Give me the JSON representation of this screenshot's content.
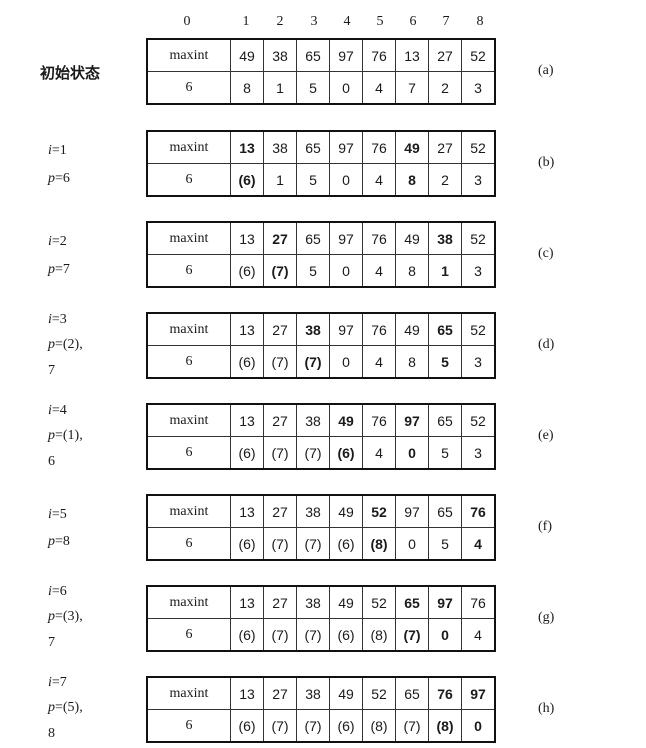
{
  "header_indices": [
    "0",
    "1",
    "2",
    "3",
    "4",
    "5",
    "6",
    "7",
    "8"
  ],
  "panels": [
    {
      "tag": "(a)",
      "label_lines": [
        "初始状态"
      ],
      "row1": [
        {
          "v": "maxint"
        },
        {
          "v": "49"
        },
        {
          "v": "38"
        },
        {
          "v": "65"
        },
        {
          "v": "97"
        },
        {
          "v": "76"
        },
        {
          "v": "13"
        },
        {
          "v": "27"
        },
        {
          "v": "52"
        }
      ],
      "row2": [
        {
          "v": "6"
        },
        {
          "v": "8"
        },
        {
          "v": "1"
        },
        {
          "v": "5"
        },
        {
          "v": "0"
        },
        {
          "v": "4"
        },
        {
          "v": "7"
        },
        {
          "v": "2"
        },
        {
          "v": "3"
        }
      ]
    },
    {
      "tag": "(b)",
      "label_lines": [
        "i=1",
        "p=6"
      ],
      "row1": [
        {
          "v": "maxint"
        },
        {
          "v": "13",
          "b": true
        },
        {
          "v": "38"
        },
        {
          "v": "65"
        },
        {
          "v": "97"
        },
        {
          "v": "76"
        },
        {
          "v": "49",
          "b": true
        },
        {
          "v": "27"
        },
        {
          "v": "52"
        }
      ],
      "row2": [
        {
          "v": "6"
        },
        {
          "v": "(6)",
          "b": true
        },
        {
          "v": "1"
        },
        {
          "v": "5"
        },
        {
          "v": "0"
        },
        {
          "v": "4"
        },
        {
          "v": "8",
          "b": true
        },
        {
          "v": "2"
        },
        {
          "v": "3"
        }
      ]
    },
    {
      "tag": "(c)",
      "label_lines": [
        "i=2",
        "p=7"
      ],
      "row1": [
        {
          "v": "maxint"
        },
        {
          "v": "13"
        },
        {
          "v": "27",
          "b": true
        },
        {
          "v": "65"
        },
        {
          "v": "97"
        },
        {
          "v": "76"
        },
        {
          "v": "49"
        },
        {
          "v": "38",
          "b": true
        },
        {
          "v": "52"
        }
      ],
      "row2": [
        {
          "v": "6"
        },
        {
          "v": "(6)"
        },
        {
          "v": "(7)",
          "b": true
        },
        {
          "v": "5"
        },
        {
          "v": "0"
        },
        {
          "v": "4"
        },
        {
          "v": "8"
        },
        {
          "v": "1",
          "b": true
        },
        {
          "v": "3"
        }
      ]
    },
    {
      "tag": "(d)",
      "label_lines": [
        "i=3",
        "p=(2),",
        "7"
      ],
      "row1": [
        {
          "v": "maxint"
        },
        {
          "v": "13"
        },
        {
          "v": "27"
        },
        {
          "v": "38",
          "b": true
        },
        {
          "v": "97"
        },
        {
          "v": "76"
        },
        {
          "v": "49"
        },
        {
          "v": "65",
          "b": true
        },
        {
          "v": "52"
        }
      ],
      "row2": [
        {
          "v": "6"
        },
        {
          "v": "(6)"
        },
        {
          "v": "(7)"
        },
        {
          "v": "(7)",
          "b": true
        },
        {
          "v": "0"
        },
        {
          "v": "4"
        },
        {
          "v": "8"
        },
        {
          "v": "5",
          "b": true
        },
        {
          "v": "3"
        }
      ]
    },
    {
      "tag": "(e)",
      "label_lines": [
        "i=4",
        "p=(1),",
        "6"
      ],
      "row1": [
        {
          "v": "maxint"
        },
        {
          "v": "13"
        },
        {
          "v": "27"
        },
        {
          "v": "38"
        },
        {
          "v": "49",
          "b": true
        },
        {
          "v": "76"
        },
        {
          "v": "97",
          "b": true
        },
        {
          "v": "65"
        },
        {
          "v": "52"
        }
      ],
      "row2": [
        {
          "v": "6"
        },
        {
          "v": "(6)"
        },
        {
          "v": "(7)"
        },
        {
          "v": "(7)"
        },
        {
          "v": "(6)",
          "b": true
        },
        {
          "v": "4"
        },
        {
          "v": "0",
          "b": true
        },
        {
          "v": "5"
        },
        {
          "v": "3"
        }
      ]
    },
    {
      "tag": "(f)",
      "label_lines": [
        "i=5",
        "p=8"
      ],
      "row1": [
        {
          "v": "maxint"
        },
        {
          "v": "13"
        },
        {
          "v": "27"
        },
        {
          "v": "38"
        },
        {
          "v": "49"
        },
        {
          "v": "52",
          "b": true
        },
        {
          "v": "97"
        },
        {
          "v": "65"
        },
        {
          "v": "76",
          "b": true
        }
      ],
      "row2": [
        {
          "v": "6"
        },
        {
          "v": "(6)"
        },
        {
          "v": "(7)"
        },
        {
          "v": "(7)"
        },
        {
          "v": "(6)"
        },
        {
          "v": "(8)",
          "b": true
        },
        {
          "v": "0"
        },
        {
          "v": "5"
        },
        {
          "v": "4",
          "b": true
        }
      ]
    },
    {
      "tag": "(g)",
      "label_lines": [
        "i=6",
        "p=(3),",
        "7"
      ],
      "row1": [
        {
          "v": "maxint"
        },
        {
          "v": "13"
        },
        {
          "v": "27"
        },
        {
          "v": "38"
        },
        {
          "v": "49"
        },
        {
          "v": "52"
        },
        {
          "v": "65",
          "b": true
        },
        {
          "v": "97",
          "b": true
        },
        {
          "v": "76"
        }
      ],
      "row2": [
        {
          "v": "6"
        },
        {
          "v": "(6)"
        },
        {
          "v": "(7)"
        },
        {
          "v": "(7)"
        },
        {
          "v": "(6)"
        },
        {
          "v": "(8)"
        },
        {
          "v": "(7)",
          "b": true
        },
        {
          "v": "0",
          "b": true
        },
        {
          "v": "4"
        }
      ]
    },
    {
      "tag": "(h)",
      "label_lines": [
        "i=7",
        "p=(5),",
        "8"
      ],
      "row1": [
        {
          "v": "maxint"
        },
        {
          "v": "13"
        },
        {
          "v": "27"
        },
        {
          "v": "38"
        },
        {
          "v": "49"
        },
        {
          "v": "52"
        },
        {
          "v": "65"
        },
        {
          "v": "76",
          "b": true
        },
        {
          "v": "97",
          "b": true
        }
      ],
      "row2": [
        {
          "v": "6"
        },
        {
          "v": "(6)"
        },
        {
          "v": "(7)"
        },
        {
          "v": "(7)"
        },
        {
          "v": "(6)"
        },
        {
          "v": "(8)"
        },
        {
          "v": "(7)"
        },
        {
          "v": "(8)",
          "b": true
        },
        {
          "v": "0",
          "b": true
        }
      ]
    }
  ]
}
